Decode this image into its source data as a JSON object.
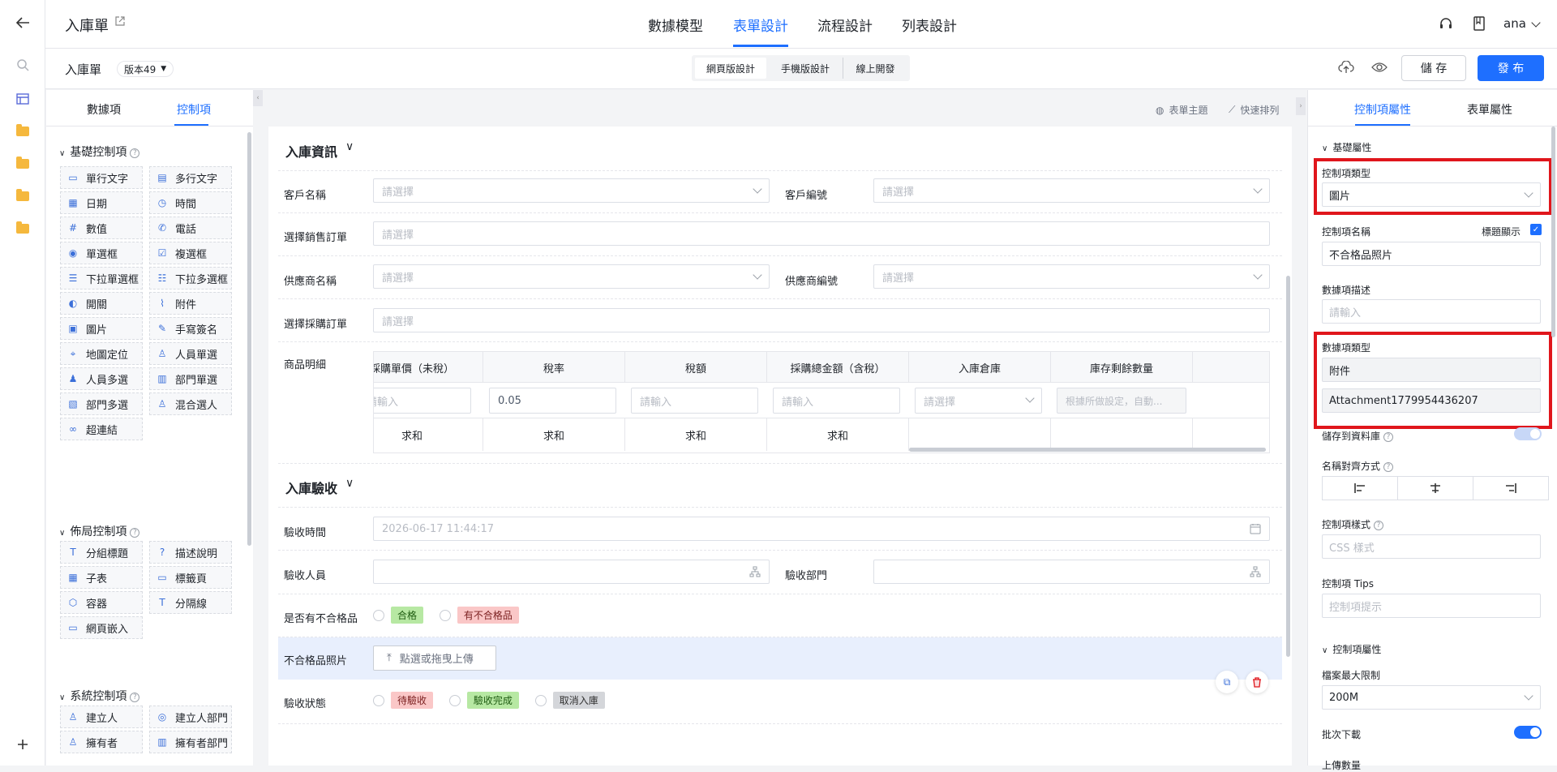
{
  "app": {
    "title": "入庫單",
    "user": "ana"
  },
  "top_tabs": [
    "數據模型",
    "表單設計",
    "流程設計",
    "列表設計"
  ],
  "subbar": {
    "form_name": "入庫單",
    "version": "版本49",
    "mode_tabs": [
      "網頁版設計",
      "手機版設計",
      "線上開發"
    ],
    "save_label": "儲 存",
    "publish_label": "發 布"
  },
  "left_panel": {
    "tabs": [
      "數據項",
      "控制項"
    ],
    "basic_title": "基礎控制項",
    "basic_items": [
      {
        "label": "單行文字",
        "icon": "text-line-icon"
      },
      {
        "label": "多行文字",
        "icon": "textarea-icon"
      },
      {
        "label": "日期",
        "icon": "calendar-icon"
      },
      {
        "label": "時間",
        "icon": "clock-icon"
      },
      {
        "label": "數值",
        "icon": "number-icon"
      },
      {
        "label": "電話",
        "icon": "phone-icon"
      },
      {
        "label": "單選框",
        "icon": "radio-icon"
      },
      {
        "label": "複選框",
        "icon": "checkbox-icon"
      },
      {
        "label": "下拉單選框",
        "icon": "dropdown-icon"
      },
      {
        "label": "下拉多選框",
        "icon": "dropdown-multi-icon"
      },
      {
        "label": "開關",
        "icon": "switch-icon"
      },
      {
        "label": "附件",
        "icon": "paperclip-icon"
      },
      {
        "label": "圖片",
        "icon": "image-icon"
      },
      {
        "label": "手寫簽名",
        "icon": "pen-icon"
      },
      {
        "label": "地圖定位",
        "icon": "location-icon"
      },
      {
        "label": "人員單選",
        "icon": "user-icon"
      },
      {
        "label": "人員多選",
        "icon": "users-icon"
      },
      {
        "label": "部門單選",
        "icon": "department-icon"
      },
      {
        "label": "部門多選",
        "icon": "departments-icon"
      },
      {
        "label": "混合選人",
        "icon": "user-mixed-icon"
      },
      {
        "label": "超連結",
        "icon": "link-icon"
      }
    ],
    "layout_title": "佈局控制項",
    "layout_items": [
      {
        "label": "分組標題",
        "icon": "title-icon"
      },
      {
        "label": "描述說明",
        "icon": "help-icon"
      },
      {
        "label": "子表",
        "icon": "table-icon"
      },
      {
        "label": "標籤頁",
        "icon": "tabs-icon"
      },
      {
        "label": "容器",
        "icon": "container-icon"
      },
      {
        "label": "分隔線",
        "icon": "divider-icon"
      },
      {
        "label": "網頁嵌入",
        "icon": "embed-icon"
      }
    ],
    "system_title": "系統控制項",
    "system_items": [
      {
        "label": "建立人",
        "icon": "creator-icon"
      },
      {
        "label": "建立人部門",
        "icon": "creator-dept-icon"
      },
      {
        "label": "擁有者",
        "icon": "owner-icon"
      },
      {
        "label": "擁有者部門",
        "icon": "owner-dept-icon"
      }
    ]
  },
  "canvas_toolbar": {
    "theme": "表單主題",
    "arrange": "快速排列"
  },
  "form": {
    "section1_title": "入庫資訊",
    "customer_name_label": "客戶名稱",
    "customer_no_label": "客戶編號",
    "sales_order_label": "選擇銷售訂單",
    "supplier_name_label": "供應商名稱",
    "supplier_no_label": "供應商編號",
    "purchase_order_label": "選擇採購訂單",
    "product_detail_label": "商品明細",
    "select_placeholder": "請選擇",
    "input_placeholder": "請輸入",
    "table": {
      "headers": [
        "採購單價（未稅）",
        "稅率",
        "稅額",
        "採購總金額（含稅）",
        "入庫倉庫",
        "庫存剩餘數量"
      ],
      "row": [
        "請輸入",
        "0.05",
        "請輸入",
        "請輸入",
        "請選擇",
        "根據所做設定，自動..."
      ],
      "sum_label": "求和"
    },
    "section2_title": "入庫驗收",
    "check_time_label": "驗收時間",
    "check_time_value": "2026-06-17 11:44:17",
    "check_person_label": "驗收人員",
    "check_dept_label": "驗收部門",
    "defect_label": "是否有不合格品",
    "defect_options": [
      "合格",
      "有不合格品"
    ],
    "defect_photo_label": "不合格品照片",
    "upload_label": "點選或拖曳上傳",
    "status_label": "驗收狀態",
    "status_options": [
      "待驗收",
      "驗收完成",
      "取消入庫"
    ]
  },
  "right_panel": {
    "tabs": [
      "控制項屬性",
      "表單屬性"
    ],
    "basic_section": "基礎屬性",
    "control_type_label": "控制項類型",
    "control_type_value": "圖片",
    "control_name_label": "控制項名稱",
    "title_display_label": "標題顯示",
    "control_name_value": "不合格品照片",
    "data_desc_label": "數據項描述",
    "data_desc_placeholder": "請輸入",
    "data_type_label": "數據項類型",
    "data_type_value": "附件",
    "data_code_value": "Attachment1779954436207",
    "save_db_label": "儲存到資料庫",
    "align_label": "名稱對齊方式",
    "style_label": "控制項樣式",
    "style_placeholder": "CSS 樣式",
    "tips_label": "控制項 Tips",
    "tips_placeholder": "控制項提示",
    "control_section": "控制項屬性",
    "max_size_label": "檔案最大限制",
    "max_size_value": "200M",
    "batch_download_label": "批次下載",
    "upload_count_label": "上傳數量"
  },
  "colors": {
    "accent": "#1e6fff",
    "highlight_red": "#e0161c",
    "selected_row": "#e8effd"
  }
}
